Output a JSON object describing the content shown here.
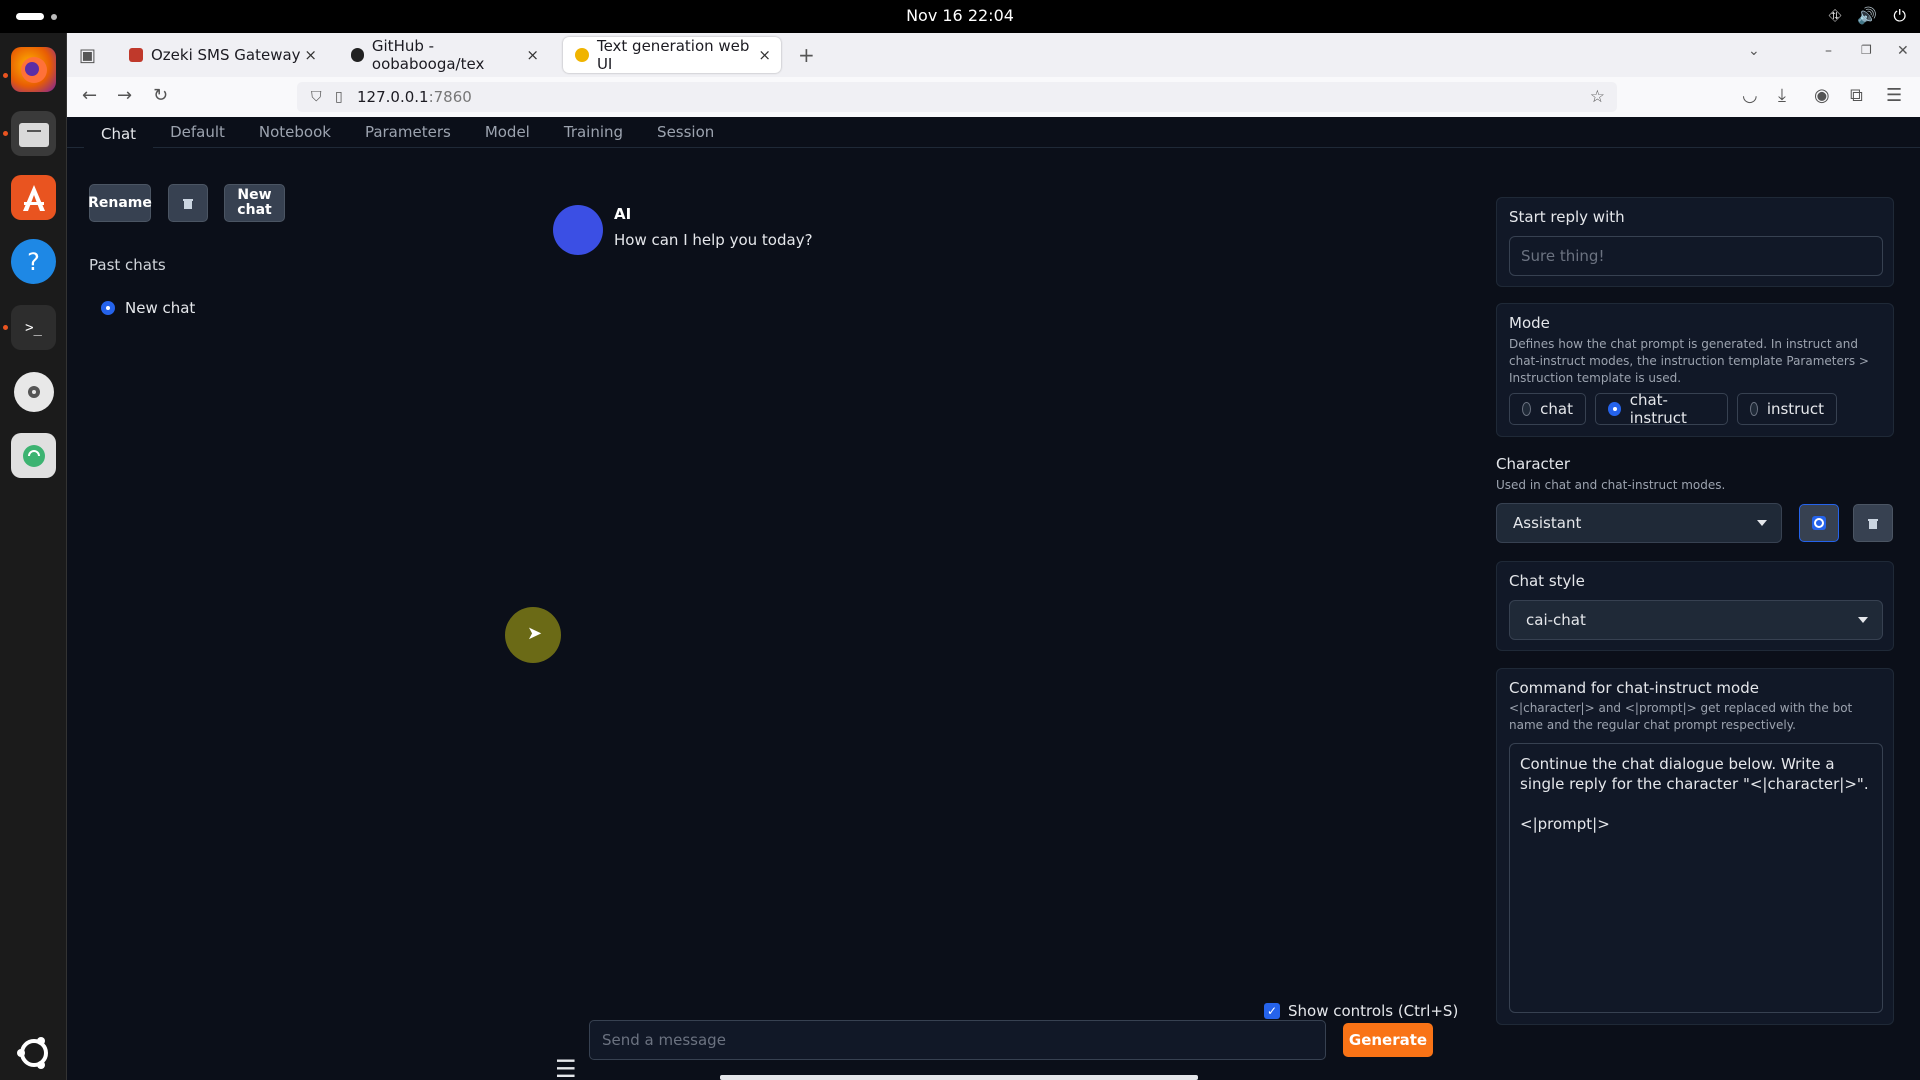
{
  "os": {
    "clock": "Nov 16  22:04",
    "tray_icons": [
      "network-icon",
      "volume-icon",
      "power-icon"
    ]
  },
  "dock": {
    "apps": [
      "firefox-icon",
      "files-icon",
      "app-center-icon",
      "help-icon",
      "terminal-icon",
      "disc-icon",
      "trash-icon"
    ],
    "bottom": "ubuntu-icon"
  },
  "browser": {
    "tabs": [
      {
        "label": "Ozeki SMS Gateway",
        "active": false
      },
      {
        "label": "GitHub - oobabooga/tex",
        "active": false
      },
      {
        "label": "Text generation web UI",
        "active": true
      }
    ],
    "url_host": "127.0.0.1",
    "url_port": ":7860"
  },
  "app": {
    "menu": [
      "Chat",
      "Default",
      "Notebook",
      "Parameters",
      "Model",
      "Training",
      "Session"
    ],
    "active_menu": "Chat",
    "sidebar": {
      "rename_label": "Rename",
      "new_chat_label": "New chat",
      "past_chats_label": "Past chats",
      "past_chats": [
        "New chat"
      ]
    },
    "chat": {
      "ai_name": "AI",
      "ai_message": "How can I help you today?",
      "show_controls_label": "Show controls (Ctrl+S)",
      "input_placeholder": "Send a message",
      "generate_label": "Generate"
    },
    "right": {
      "start_reply_title": "Start reply with",
      "start_reply_placeholder": "Sure thing!",
      "mode_title": "Mode",
      "mode_desc": "Defines how the chat prompt is generated. In instruct and chat-instruct modes, the instruction template Parameters > Instruction template is used.",
      "mode_options": [
        "chat",
        "chat-instruct",
        "instruct"
      ],
      "mode_selected": "chat-instruct",
      "character_title": "Character",
      "character_desc": "Used in chat and chat-instruct modes.",
      "character_value": "Assistant",
      "chat_style_title": "Chat style",
      "chat_style_value": "cai-chat",
      "command_title": "Command for chat-instruct mode",
      "command_desc": "<|character|> and <|prompt|> get replaced with the bot name and the regular chat prompt respectively.",
      "command_text": "Continue the chat dialogue below. Write a single reply for the character \"<|character|>\".\n\n<|prompt|>"
    }
  }
}
